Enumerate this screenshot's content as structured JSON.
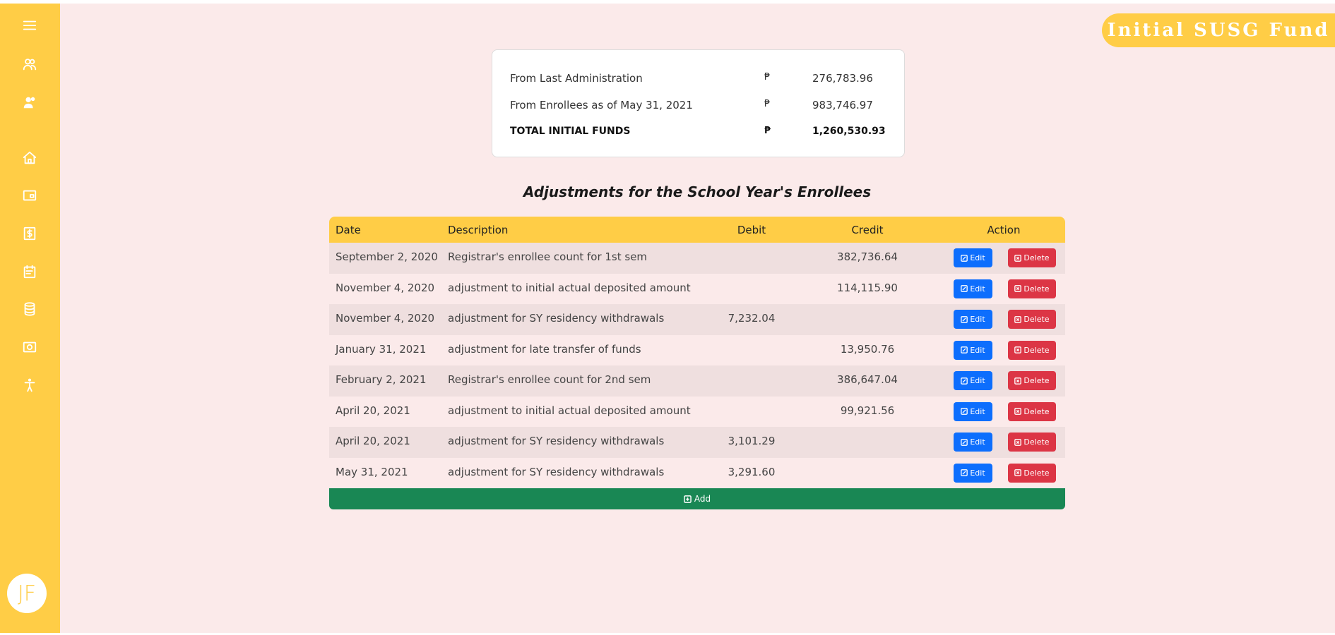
{
  "app": {
    "title": "Initial SUSG Fund",
    "avatar_initials": "JF",
    "colors": {
      "accent": "#ffcd46",
      "background": "#fbeaea",
      "edit": "#0d6efd",
      "delete": "#dc3545",
      "add": "#198754"
    }
  },
  "sidebar": {
    "items": [
      {
        "icon": "menu-icon"
      },
      {
        "icon": "users-icon"
      },
      {
        "icon": "user-group-icon"
      },
      {
        "icon": "home-icon"
      },
      {
        "icon": "card-icon"
      },
      {
        "icon": "dollar-icon"
      },
      {
        "icon": "calendar-icon"
      },
      {
        "icon": "database-icon"
      },
      {
        "icon": "money-icon"
      },
      {
        "icon": "accessibility-icon"
      }
    ]
  },
  "summary": {
    "rows": [
      {
        "label": "From Last Administration",
        "currency": "₱",
        "amount": "276,783.96"
      },
      {
        "label": "From Enrollees as of May 31, 2021",
        "currency": "₱",
        "amount": "983,746.97"
      },
      {
        "label": "TOTAL INITIAL FUNDS",
        "currency": "₱",
        "amount": "1,260,530.93"
      }
    ]
  },
  "adjustments": {
    "heading": "Adjustments for the School Year's Enrollees",
    "columns": {
      "date": "Date",
      "description": "Description",
      "debit": "Debit",
      "credit": "Credit",
      "action": "Action"
    },
    "edit_label": "Edit",
    "delete_label": "Delete",
    "add_label": "Add",
    "rows": [
      {
        "date": "September 2, 2020",
        "description": "Registrar's enrollee count for 1st sem",
        "debit": "",
        "credit": "382,736.64"
      },
      {
        "date": "November 4, 2020",
        "description": "adjustment to initial actual deposited amount",
        "debit": "",
        "credit": "114,115.90"
      },
      {
        "date": "November 4, 2020",
        "description": "adjustment for SY residency withdrawals",
        "debit": "7,232.04",
        "credit": ""
      },
      {
        "date": "January 31, 2021",
        "description": "adjustment for late transfer of funds",
        "debit": "",
        "credit": "13,950.76"
      },
      {
        "date": "February 2, 2021",
        "description": "Registrar's enrollee count for 2nd sem",
        "debit": "",
        "credit": "386,647.04"
      },
      {
        "date": "April 20, 2021",
        "description": "adjustment to initial actual deposited amount",
        "debit": "",
        "credit": "99,921.56"
      },
      {
        "date": "April 20, 2021",
        "description": "adjustment for SY residency withdrawals",
        "debit": "3,101.29",
        "credit": ""
      },
      {
        "date": "May 31, 2021",
        "description": "adjustment for SY residency withdrawals",
        "debit": "3,291.60",
        "credit": ""
      }
    ]
  }
}
